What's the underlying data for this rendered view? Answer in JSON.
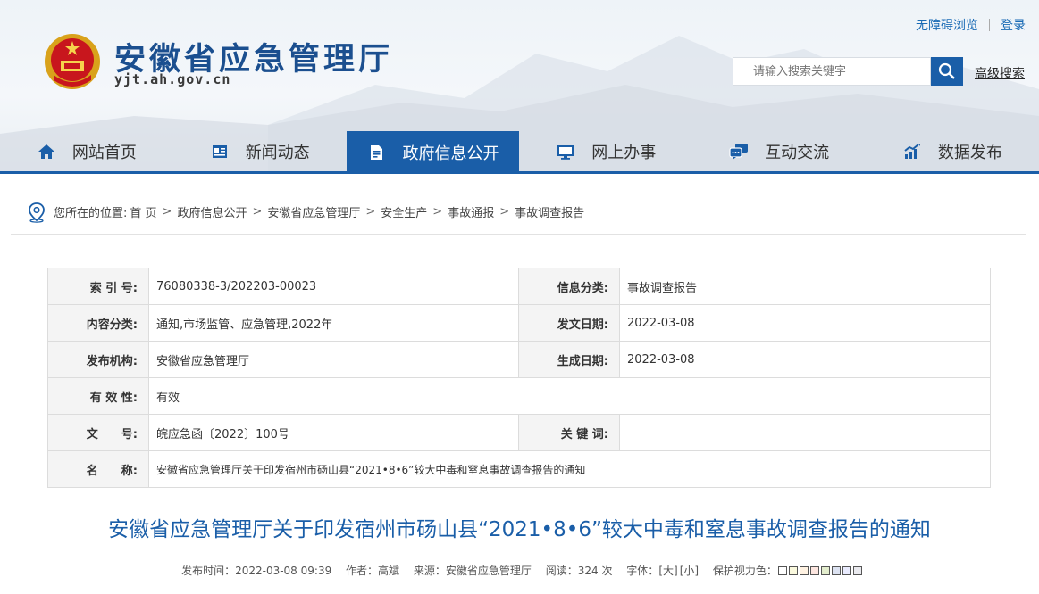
{
  "header": {
    "site_title": "安徽省应急管理厅",
    "site_domain": "yjt.ah.gov.cn",
    "top_links": [
      "无障碍浏览",
      "登录"
    ],
    "search_placeholder": "请输入搜索关键字",
    "advanced_search": "高级搜索"
  },
  "nav": [
    {
      "label": "网站首页",
      "icon": "home-icon"
    },
    {
      "label": "新闻动态",
      "icon": "news-icon"
    },
    {
      "label": "政府信息公开",
      "icon": "document-icon",
      "active": true
    },
    {
      "label": "网上办事",
      "icon": "monitor-icon"
    },
    {
      "label": "互动交流",
      "icon": "chat-icon"
    },
    {
      "label": "数据发布",
      "icon": "chart-icon"
    }
  ],
  "breadcrumb": {
    "prefix": "您所在的位置:",
    "items": [
      "首 页",
      "政府信息公开",
      "安徽省应急管理厅",
      "安全生产",
      "事故通报",
      "事故调查报告"
    ]
  },
  "info": {
    "index_label": "索 引 号:",
    "index_value": "76080338-3/202203-00023",
    "category_label": "信息分类:",
    "category_value": "事故调查报告",
    "content_label": "内容分类:",
    "content_value": "通知,市场监管、应急管理,2022年",
    "issue_date_label": "发文日期:",
    "issue_date_value": "2022-03-08",
    "publisher_label": "发布机构:",
    "publisher_value": "安徽省应急管理厅",
    "gen_date_label": "生成日期:",
    "gen_date_value": "2022-03-08",
    "validity_label": "有 效 性:",
    "validity_value": "有效",
    "docno_label": "文　　号:",
    "docno_value": "皖应急函〔2022〕100号",
    "keyword_label": "关 键 词:",
    "keyword_value": "",
    "name_label": "名　　称:",
    "name_value": "安徽省应急管理厅关于印发宿州市砀山县“2021•8•6”较大中毒和窒息事故调查报告的通知"
  },
  "article": {
    "title": "安徽省应急管理厅关于印发宿州市砀山县“2021•8•6”较大中毒和窒息事故调查报告的通知",
    "publish_time": "发布时间：2022-03-08 09:39",
    "author": "作者：高斌",
    "source": "来源：安徽省应急管理厅",
    "reads": "阅读：324 次",
    "font_label": "字体：",
    "font_large": "[大]",
    "font_small": "[小]",
    "eye_protect": "保护视力色："
  },
  "colors": {
    "brand": "#1a5ea8",
    "eye_swatches": [
      "#ffffff",
      "#faf9de",
      "#fff2e2",
      "#fde6e0",
      "#e3edcd",
      "#dce2f1",
      "#e9ebfe",
      "#eaeaef"
    ]
  }
}
